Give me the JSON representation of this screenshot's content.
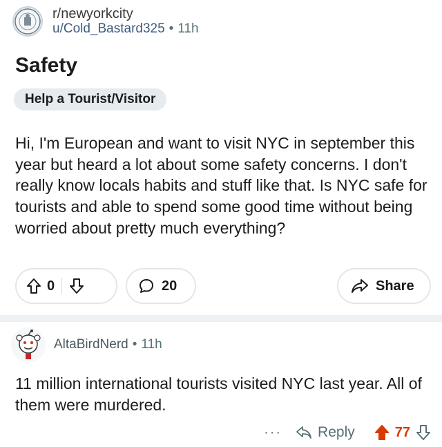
{
  "post": {
    "subreddit": "r/newyorkcity",
    "author": "u/Cold_Bastard325",
    "separator": "•",
    "age": "11h",
    "title": "Safety",
    "flair": "Help a Tourist/Visitor",
    "body": "Hi, I'm European and want to visit NYC in september this year but heard a lot about some safety concerns. I don't really know locals habits and stuff like that. Is NYC safe for tourists and able to spend some good time without being worried about pretty much everything?",
    "vote_count": "0",
    "comment_count": "20",
    "share_label": "Share"
  },
  "comment": {
    "author": "AltaBirdNerd",
    "separator": "•",
    "age": "11h",
    "text": "11 million international tourists visited NYC last year. All of them were murdered.",
    "more_label": "···",
    "reply_label": "Reply",
    "vote_count": "77",
    "upvote_color": "#d93a00"
  },
  "icons": {
    "upvote": "upvote-arrow-icon",
    "downvote": "downvote-arrow-icon",
    "comment": "speech-bubble-icon",
    "share": "share-arrow-icon",
    "reply": "reply-arrow-icon"
  }
}
